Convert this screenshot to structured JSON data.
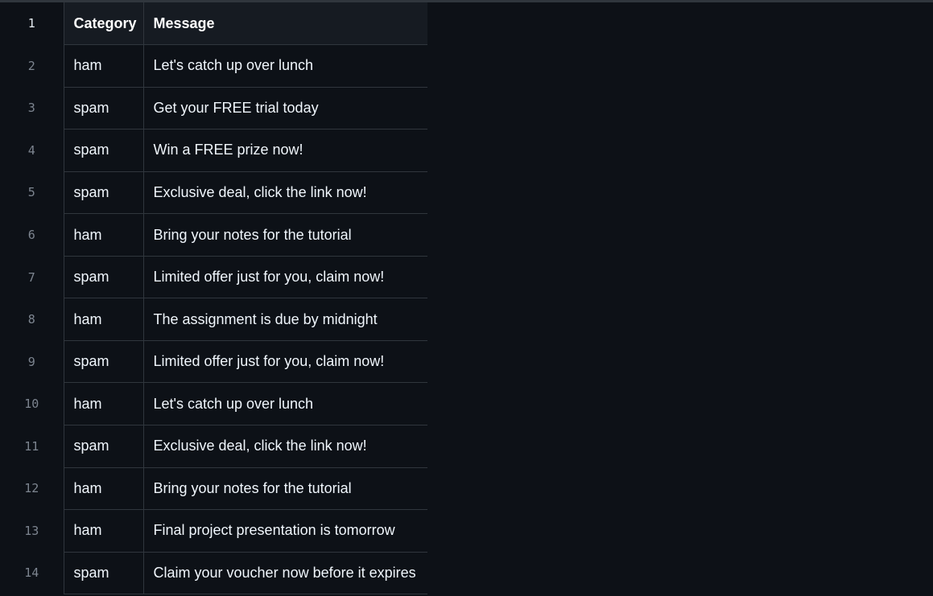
{
  "table": {
    "headers": [
      "Category",
      "Message"
    ],
    "header_line_number": "1",
    "rows": [
      {
        "line": "2",
        "category": "ham",
        "message": "Let's catch up over lunch"
      },
      {
        "line": "3",
        "category": "spam",
        "message": "Get your FREE trial today"
      },
      {
        "line": "4",
        "category": "spam",
        "message": "Win a FREE prize now!"
      },
      {
        "line": "5",
        "category": "spam",
        "message": "Exclusive deal, click the link now!"
      },
      {
        "line": "6",
        "category": "ham",
        "message": "Bring your notes for the tutorial"
      },
      {
        "line": "7",
        "category": "spam",
        "message": "Limited offer just for you, claim now!"
      },
      {
        "line": "8",
        "category": "ham",
        "message": "The assignment is due by midnight"
      },
      {
        "line": "9",
        "category": "spam",
        "message": "Limited offer just for you, claim now!"
      },
      {
        "line": "10",
        "category": "ham",
        "message": "Let's catch up over lunch"
      },
      {
        "line": "11",
        "category": "spam",
        "message": "Exclusive deal, click the link now!"
      },
      {
        "line": "12",
        "category": "ham",
        "message": "Bring your notes for the tutorial"
      },
      {
        "line": "13",
        "category": "ham",
        "message": "Final project presentation is tomorrow"
      },
      {
        "line": "14",
        "category": "spam",
        "message": "Claim your voucher now before it expires"
      }
    ]
  },
  "colors": {
    "background": "#0d1117",
    "header_background": "#161b22",
    "border": "#30363d",
    "line_number": "#7d8590",
    "text": "#f0f6fc"
  }
}
